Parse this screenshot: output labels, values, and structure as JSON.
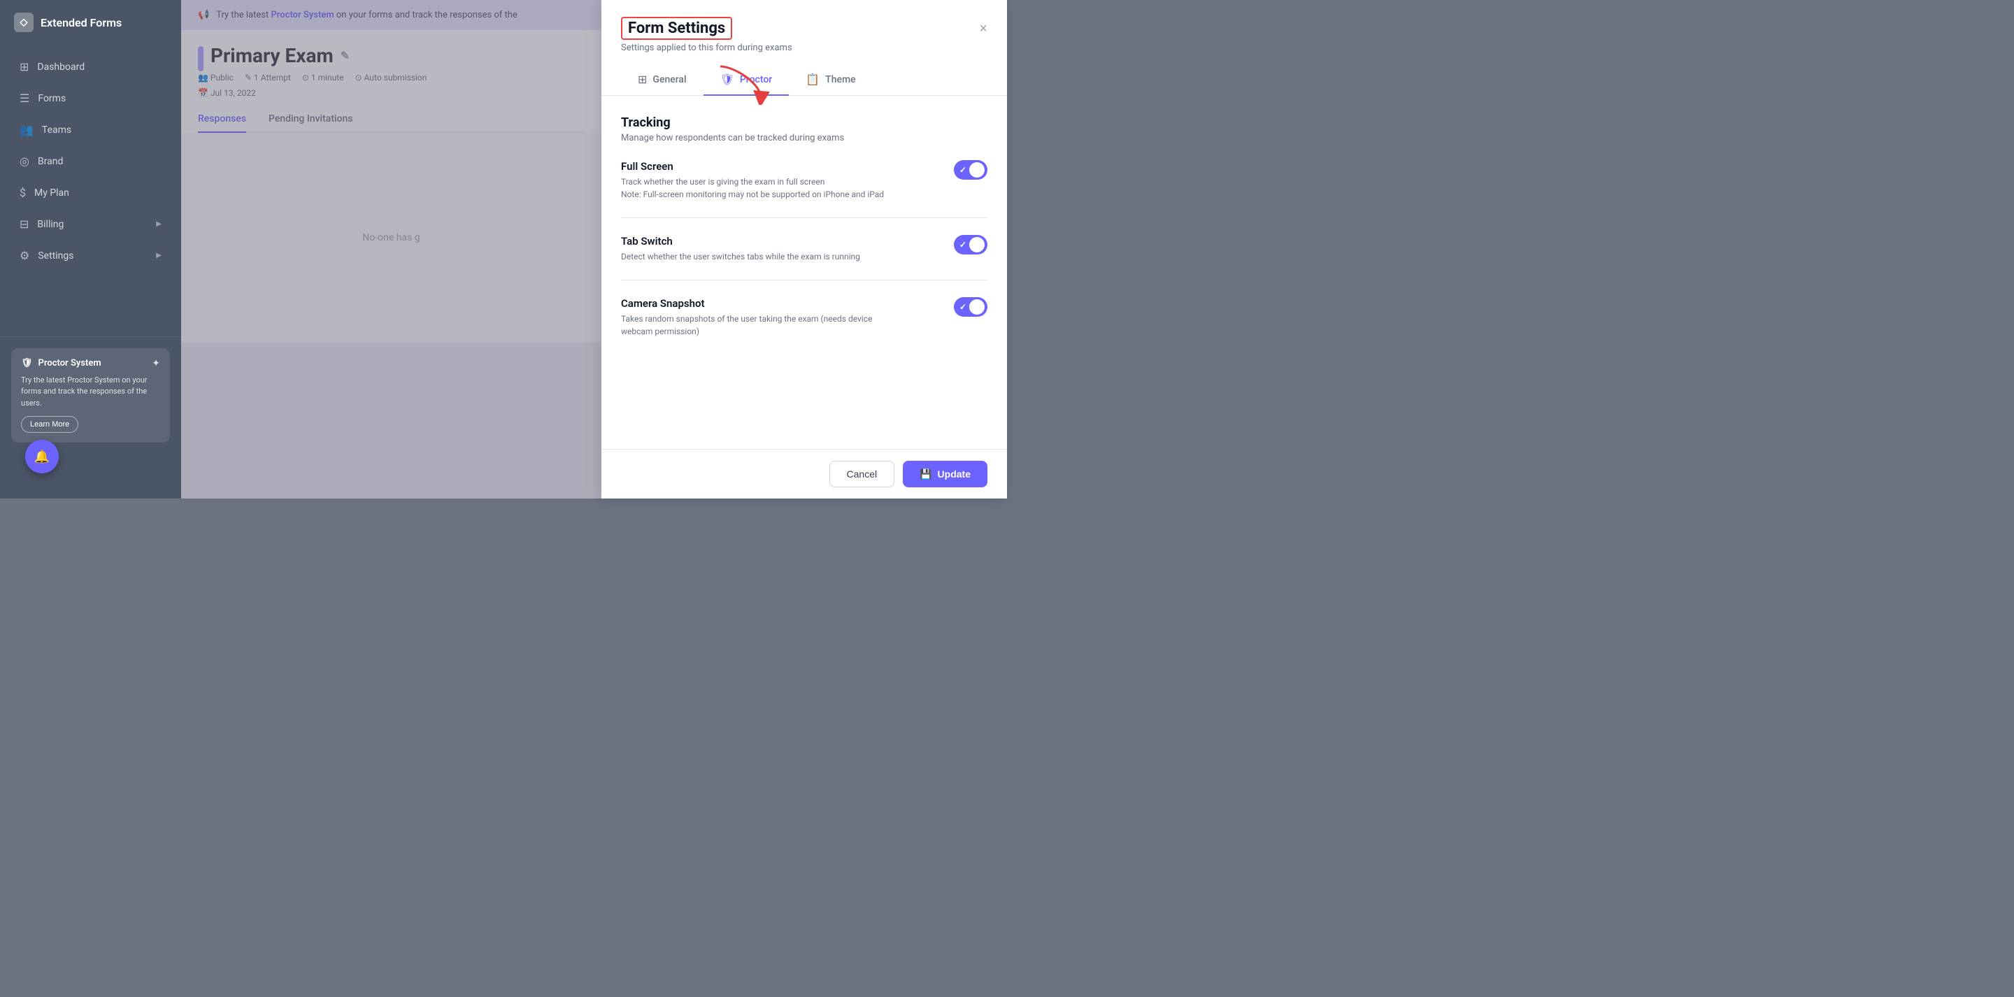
{
  "app": {
    "name": "Extended Forms",
    "logo_icon": "◇"
  },
  "sidebar": {
    "items": [
      {
        "id": "dashboard",
        "label": "Dashboard",
        "icon": "▦"
      },
      {
        "id": "forms",
        "label": "Forms",
        "icon": "≡"
      },
      {
        "id": "teams",
        "label": "Teams",
        "icon": "👥"
      },
      {
        "id": "brand",
        "label": "Brand",
        "icon": "$"
      },
      {
        "id": "my-plan",
        "label": "My Plan",
        "icon": "$"
      },
      {
        "id": "billing",
        "label": "Billing",
        "icon": "🧾"
      },
      {
        "id": "settings",
        "label": "Settings",
        "icon": "⚙"
      }
    ],
    "proctor_card": {
      "title": "Proctor System",
      "icon": "🛡",
      "stars_icon": "✦",
      "text": "Try the latest Proctor System on your forms and track the responses of the users.",
      "learn_more": "Learn More"
    },
    "notification_icon": "🔔"
  },
  "main": {
    "banner": {
      "icon": "📢",
      "text": "Try the latest ",
      "link": "Proctor System",
      "text2": " on your forms and track the responses of the"
    },
    "form": {
      "title": "Primary Exam",
      "visibility": "Public",
      "attempts": "1 Attempt",
      "duration": "1 minute",
      "submission": "Auto submission",
      "date": "Jul 13, 2022",
      "tabs": [
        {
          "id": "responses",
          "label": "Responses",
          "active": true
        },
        {
          "id": "pending",
          "label": "Pending Invitations",
          "active": false
        }
      ],
      "empty_text": "No-one has g"
    }
  },
  "panel": {
    "title": "Form Settings",
    "subtitle": "Settings applied to this form during exams",
    "close_label": "×",
    "tabs": [
      {
        "id": "general",
        "label": "General",
        "icon": "⊞",
        "active": false
      },
      {
        "id": "proctor",
        "label": "Proctor",
        "icon": "🛡",
        "active": true
      },
      {
        "id": "theme",
        "label": "Theme",
        "icon": "📋",
        "active": false
      }
    ],
    "tracking": {
      "title": "Tracking",
      "subtitle": "Manage how respondents can be tracked during exams",
      "items": [
        {
          "id": "full-screen",
          "name": "Full Screen",
          "description": "Track whether the user is giving the exam in full screen",
          "note": "Note: Full-screen monitoring may not be supported on iPhone and iPad",
          "enabled": true
        },
        {
          "id": "tab-switch",
          "name": "Tab Switch",
          "description": "Detect whether the user switches tabs while the exam is running",
          "note": "",
          "enabled": true
        },
        {
          "id": "camera-snapshot",
          "name": "Camera Snapshot",
          "description": "Takes random snapshots of the user taking the exam (needs device webcam permission)",
          "note": "",
          "enabled": true
        }
      ]
    },
    "footer": {
      "cancel_label": "Cancel",
      "update_label": "Update",
      "update_icon": "💾"
    }
  }
}
